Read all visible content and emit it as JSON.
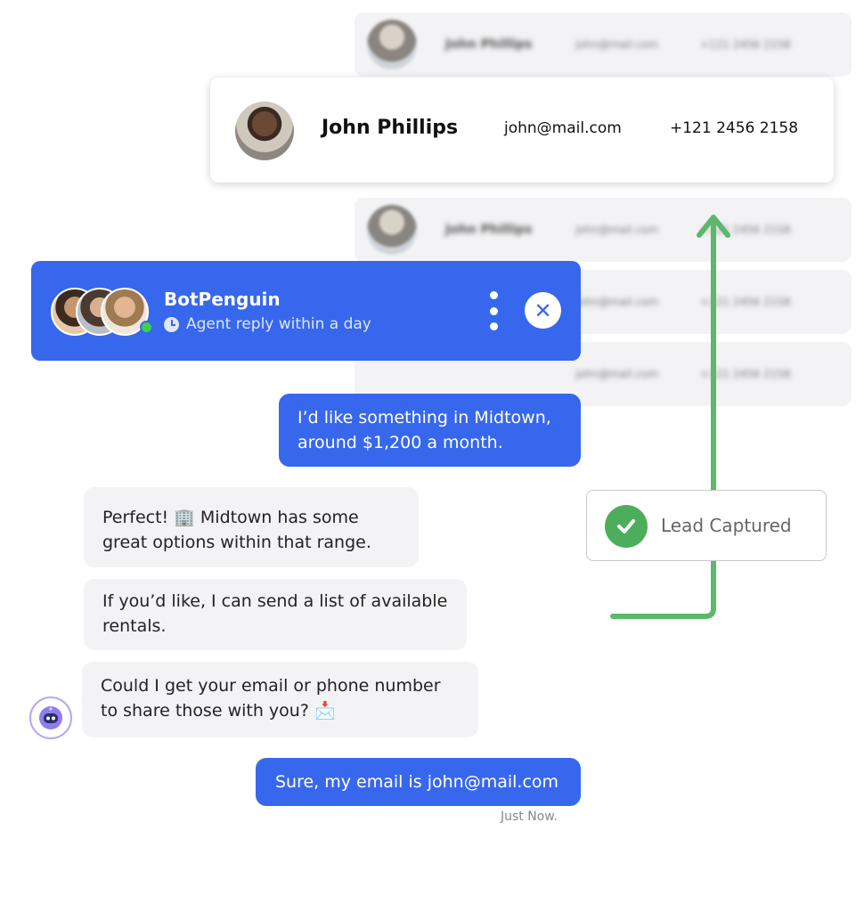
{
  "leads": {
    "blurred_rows": [
      {
        "name": "John Phillips",
        "email": "john@mail.com",
        "phone": "+121 2456 2158"
      },
      {
        "name": "John Phillips",
        "email": "john@mail.com",
        "phone": "+121 2456 2158"
      },
      {
        "name": "",
        "email": "john@mail.com",
        "phone": "+121 2456 2158"
      },
      {
        "name": "",
        "email": "john@mail.com",
        "phone": "+121 2456 2158"
      }
    ],
    "highlighted": {
      "name": "John Phillips",
      "email": "john@mail.com",
      "phone": "+121 2456 2158"
    }
  },
  "badge": {
    "label": "Lead Captured",
    "color": "#4cae5a"
  },
  "chat": {
    "header": {
      "bot_name": "BotPenguin",
      "status": "Agent reply within a day",
      "close_symbol": "✕"
    },
    "messages": {
      "user_1_line1": "I’d like something in Midtown,",
      "user_1_line2": "around $1,200 a month.",
      "bot_1_line1": "Perfect! 🏢  Midtown has some",
      "bot_1_line2": "great options within that range.",
      "bot_2_line1": "If you’d like, I can send a list of available",
      "bot_2_line2": "rentals.",
      "bot_3_line1": "Could I get your email or phone number",
      "bot_3_line2": "to share those with you? 📩",
      "user_2": "Sure, my email is john@mail.com"
    },
    "timestamp": "Just Now.",
    "accent": "#3767ec"
  }
}
